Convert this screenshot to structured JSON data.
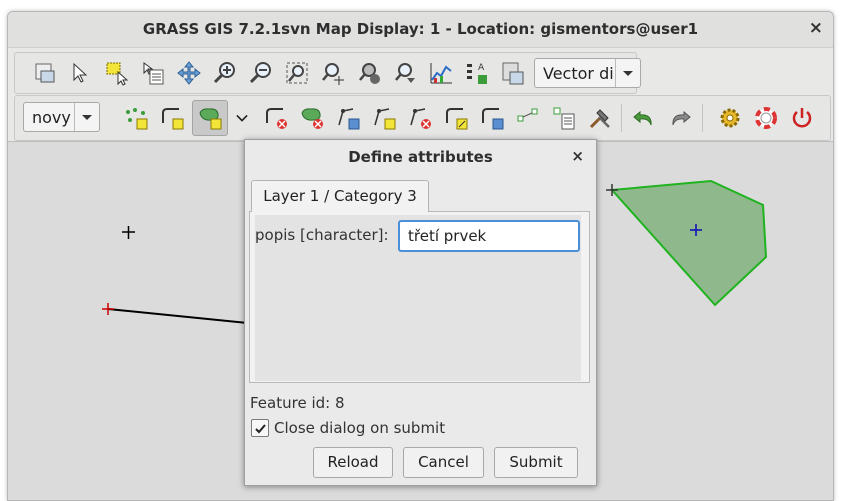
{
  "window": {
    "title": "GRASS GIS 7.2.1svn Map Display: 1 - Location: gismentors@user1",
    "close_label": "×"
  },
  "toolbar_main": {
    "tools": [
      "display-map-icon",
      "pointer-icon",
      "select-icon",
      "query-icon",
      "pan-icon",
      "zoom-in-icon",
      "zoom-out-icon",
      "zoom-extent-icon",
      "zoom-region-icon",
      "zoom-back-icon",
      "zoom-menu-icon",
      "analyze-icon",
      "overlay-icon",
      "save-map-icon"
    ],
    "mode_select": {
      "value": "Vector di"
    }
  },
  "toolbar_digitizer": {
    "layer_select": {
      "value": "novy"
    },
    "tools": [
      "new-point-icon",
      "new-line-icon",
      "new-area-icon",
      "more-tools-icon",
      "delete-line-icon",
      "delete-area-icon",
      "move-vertex-icon",
      "add-vertex-icon",
      "remove-vertex-icon",
      "edit-line-icon",
      "move-line-icon",
      "display-cats-icon",
      "display-attributes-icon",
      "additional-tools-icon",
      "undo-icon",
      "redo-icon",
      "settings-icon",
      "help-icon",
      "quit-icon"
    ]
  },
  "dialog": {
    "title": "Define attributes",
    "close_label": "×",
    "tab_label": "Layer 1 / Category 3",
    "field_label": "popis [character]:",
    "field_value": "třetí prvek",
    "feature_id": "Feature id: 8",
    "close_on_submit_label": "Close dialog on submit",
    "close_on_submit_checked": true,
    "buttons": {
      "reload": "Reload",
      "cancel": "Cancel",
      "submit": "Submit"
    }
  },
  "colors": {
    "area_fill": "#8fb98c",
    "area_stroke": "#1fb31f",
    "centroid": "#0b0bb5",
    "point": "#000000",
    "line_start": "#cc0000"
  }
}
